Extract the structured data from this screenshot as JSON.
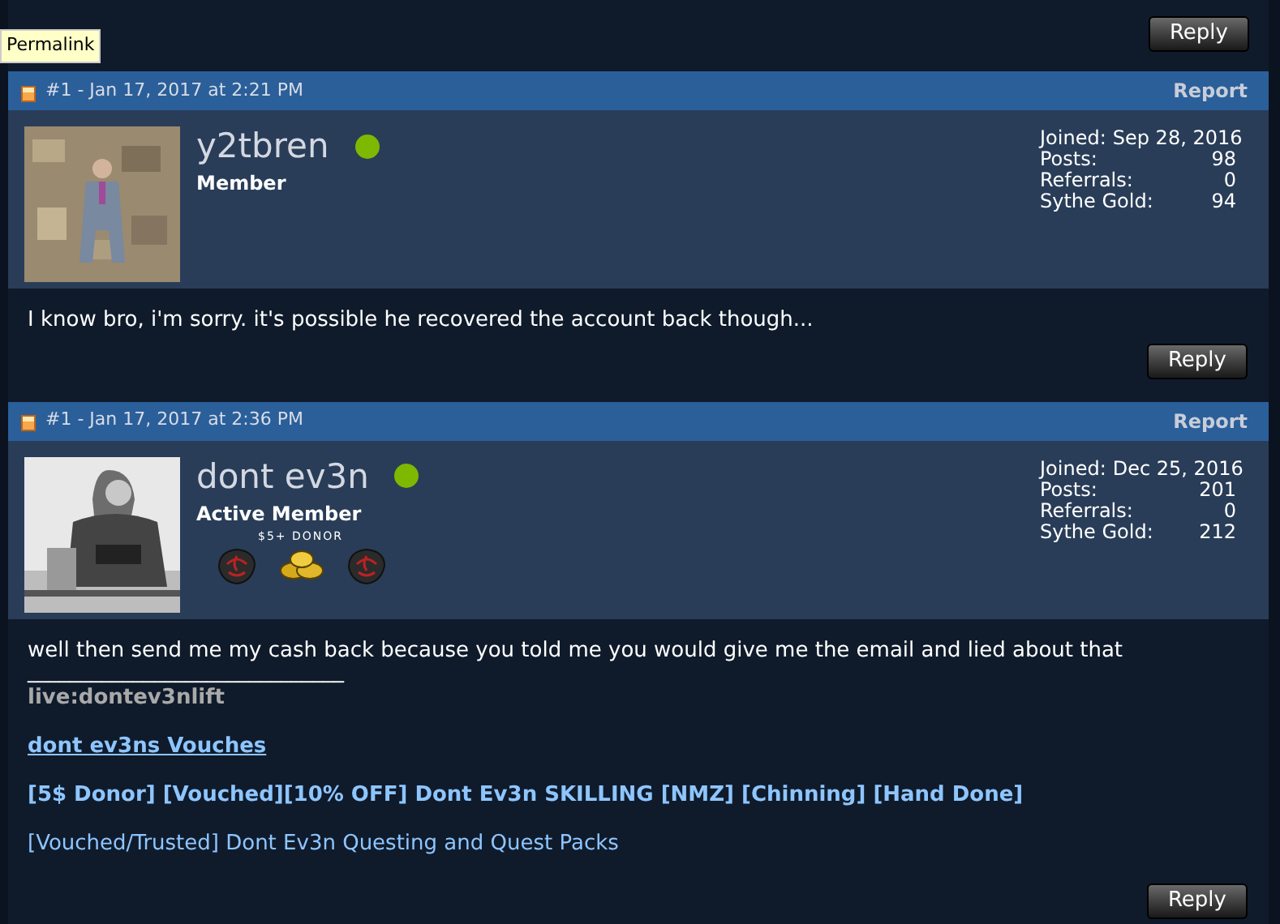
{
  "tooltip": {
    "text": "Permalink"
  },
  "top_reply": {
    "label": "Reply"
  },
  "posts": [
    {
      "number": "#1 - Jan 17, 2017 at 2:21 PM",
      "report": "Report",
      "username": "y2tbren",
      "online": true,
      "rank": "Member",
      "stats": [
        {
          "label": "Joined:",
          "value": "Sep 28, 2016"
        },
        {
          "label": "Posts:",
          "value": "98"
        },
        {
          "label": "Referrals:",
          "value": "0"
        },
        {
          "label": "Sythe Gold:",
          "value": "94"
        }
      ],
      "body": "I know bro, i'm sorry. it's possible he recovered the account back though...",
      "reply": "Reply"
    },
    {
      "number": "#1 - Jan 17, 2017 at 2:36 PM",
      "report": "Report",
      "username": "dont ev3n",
      "online": true,
      "rank": "Active Member",
      "donor": {
        "label": "$5+ DONOR"
      },
      "stats": [
        {
          "label": "Joined:",
          "value": "Dec 25, 2016"
        },
        {
          "label": "Posts:",
          "value": "201"
        },
        {
          "label": "Referrals:",
          "value": "0"
        },
        {
          "label": "Sythe Gold:",
          "value": "212"
        }
      ],
      "body": "well then send me my cash back because you told me you would give me the email and lied about that",
      "signature": [
        {
          "kind": "rule",
          "text": "______________________________"
        },
        {
          "kind": "plain",
          "text": "live:dontev3nlift"
        },
        {
          "kind": "underlined_link",
          "text": "dont ev3ns Vouches"
        },
        {
          "kind": "bold_link",
          "text": "[5$ Donor] [Vouched][10% OFF] Dont Ev3n SKILLING [NMZ] [Chinning] [Hand Done]"
        },
        {
          "kind": "link",
          "text": "[Vouched/Trusted] Dont Ev3n Questing and Quest Packs"
        }
      ],
      "reply": "Reply"
    }
  ]
}
